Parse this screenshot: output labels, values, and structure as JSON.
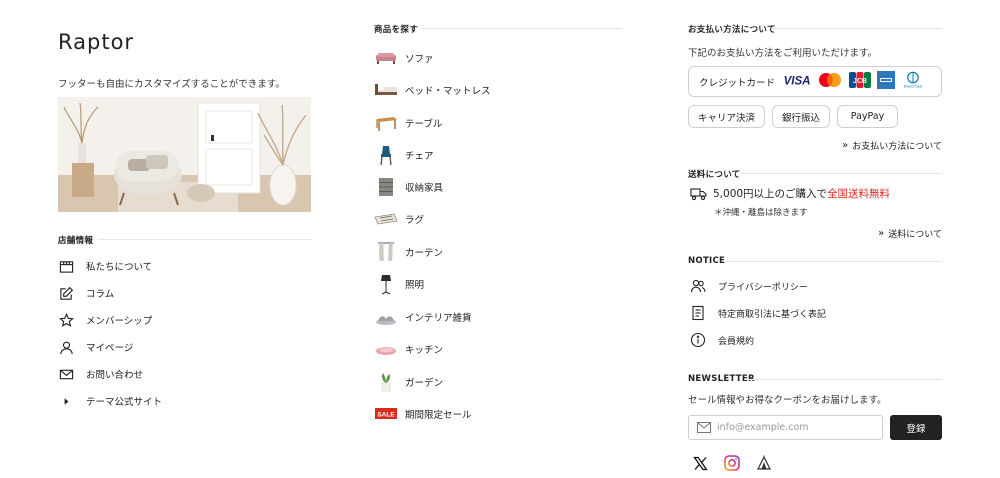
{
  "brand": {
    "name": "Raptor",
    "tagline": "フッターも自由にカスタマイズすることができます。"
  },
  "store_info": {
    "title": "店舗情報",
    "items": [
      {
        "label": "私たちについて",
        "icon": "store-icon"
      },
      {
        "label": "コラム",
        "icon": "edit-icon"
      },
      {
        "label": "メンバーシップ",
        "icon": "star-icon"
      },
      {
        "label": "マイページ",
        "icon": "user-icon"
      },
      {
        "label": "お問い合わせ",
        "icon": "mail-icon"
      },
      {
        "label": "テーマ公式サイト",
        "icon": "caret-right-icon"
      }
    ]
  },
  "categories": {
    "title": "商品を探す",
    "items": [
      {
        "label": "ソファ"
      },
      {
        "label": "ベッド・マットレス"
      },
      {
        "label": "テーブル"
      },
      {
        "label": "チェア"
      },
      {
        "label": "収納家具"
      },
      {
        "label": "ラグ"
      },
      {
        "label": "カーテン"
      },
      {
        "label": "照明"
      },
      {
        "label": "インテリア雑貨"
      },
      {
        "label": "キッチン"
      },
      {
        "label": "ガーデン"
      },
      {
        "label": "期間限定セール",
        "badge": "SALE"
      }
    ]
  },
  "payment": {
    "title": "お支払い方法について",
    "desc": "下記のお支払い方法をご利用いただけます。",
    "credit_label": "クレジットカード",
    "cards": {
      "visa": "VISA",
      "jcb": "JCB",
      "diners": "Diners Club"
    },
    "buttons": [
      "キャリア決済",
      "銀行振込",
      "PayPay"
    ],
    "link": "お支払い方法について"
  },
  "shipping": {
    "title": "送料について",
    "line_prefix": "5,000円以上のご購入で",
    "line_highlight": "全国送料無料",
    "note": "＊沖縄・離島は除きます",
    "link": "送料について"
  },
  "notice": {
    "title": "NOTICE",
    "items": [
      {
        "label": "プライバシーポリシー",
        "icon": "users-icon"
      },
      {
        "label": "特定商取引法に基づく表記",
        "icon": "document-icon"
      },
      {
        "label": "会員規約",
        "icon": "info-icon"
      }
    ]
  },
  "newsletter": {
    "title": "NEWSLETTER",
    "desc": "セール情報やお得なクーポンをお届けします。",
    "placeholder": "info@example.com",
    "button": "登録"
  },
  "colors": {
    "accent_red": "#d92b1f",
    "button_dark": "#222222"
  }
}
